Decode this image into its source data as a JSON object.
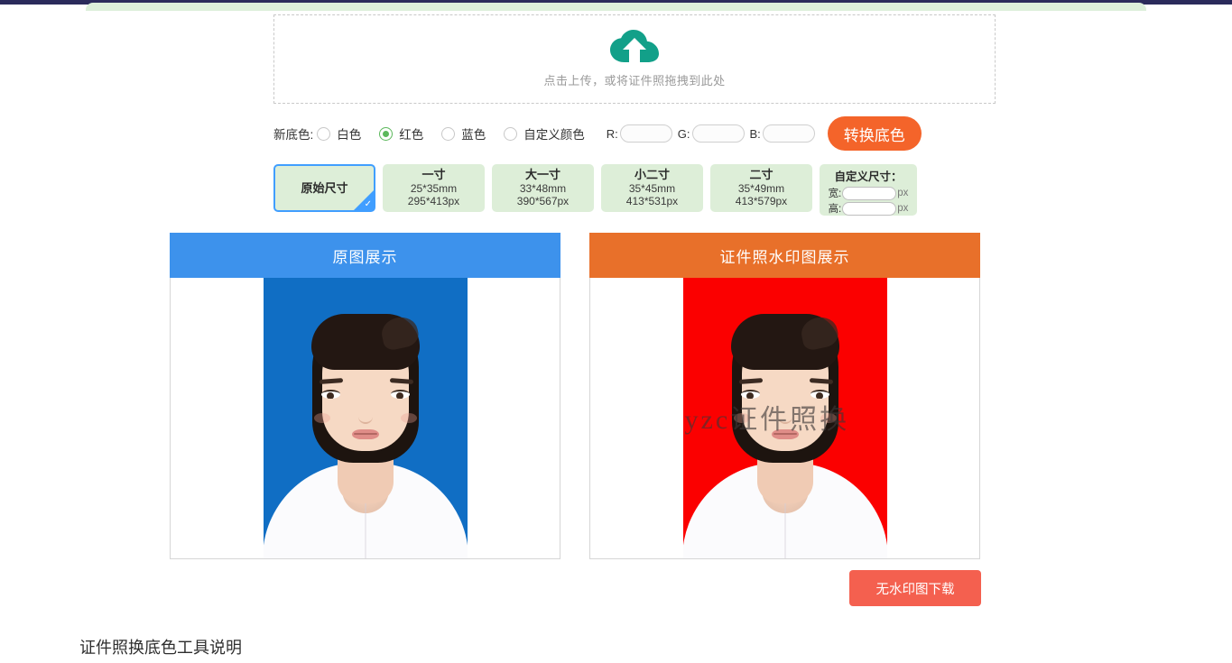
{
  "upload": {
    "icon": "cloud-upload-icon",
    "hint": "点击上传，或将证件照拖拽到此处"
  },
  "background_color": {
    "label": "新底色:",
    "options": [
      {
        "label": "白色",
        "checked": false
      },
      {
        "label": "红色",
        "checked": true
      },
      {
        "label": "蓝色",
        "checked": false
      },
      {
        "label": "自定义颜色",
        "checked": false
      }
    ],
    "rgb": [
      {
        "label": "R:",
        "value": "",
        "placeholder": ""
      },
      {
        "label": "G:",
        "value": "",
        "placeholder": ""
      },
      {
        "label": "B:",
        "value": "",
        "placeholder": ""
      }
    ],
    "convert_button": "转换底色"
  },
  "sizes": {
    "items": [
      {
        "name": "原始尺寸",
        "mm": "",
        "px": "",
        "selected": true
      },
      {
        "name": "一寸",
        "mm": "25*35mm",
        "px": "295*413px",
        "selected": false
      },
      {
        "name": "大一寸",
        "mm": "33*48mm",
        "px": "390*567px",
        "selected": false
      },
      {
        "name": "小二寸",
        "mm": "35*45mm",
        "px": "413*531px",
        "selected": false
      },
      {
        "name": "二寸",
        "mm": "35*49mm",
        "px": "413*579px",
        "selected": false
      }
    ],
    "custom": {
      "title": "自定义尺寸：",
      "width_label": "宽:",
      "width_value": "",
      "height_label": "高:",
      "height_value": "",
      "unit": "px"
    }
  },
  "panels": {
    "original": {
      "title": "原图展示",
      "header_color": "#3d92ec",
      "photo_background": "#106ec4"
    },
    "watermarked": {
      "title": "证件照水印图展示",
      "header_color": "#e8702a",
      "photo_background": "#fb0000",
      "watermark_text": "yzc证件照换"
    }
  },
  "download": {
    "label": "无水印图下载",
    "color": "#f4604f"
  },
  "footer": {
    "heading": "证件照换底色工具说明"
  }
}
